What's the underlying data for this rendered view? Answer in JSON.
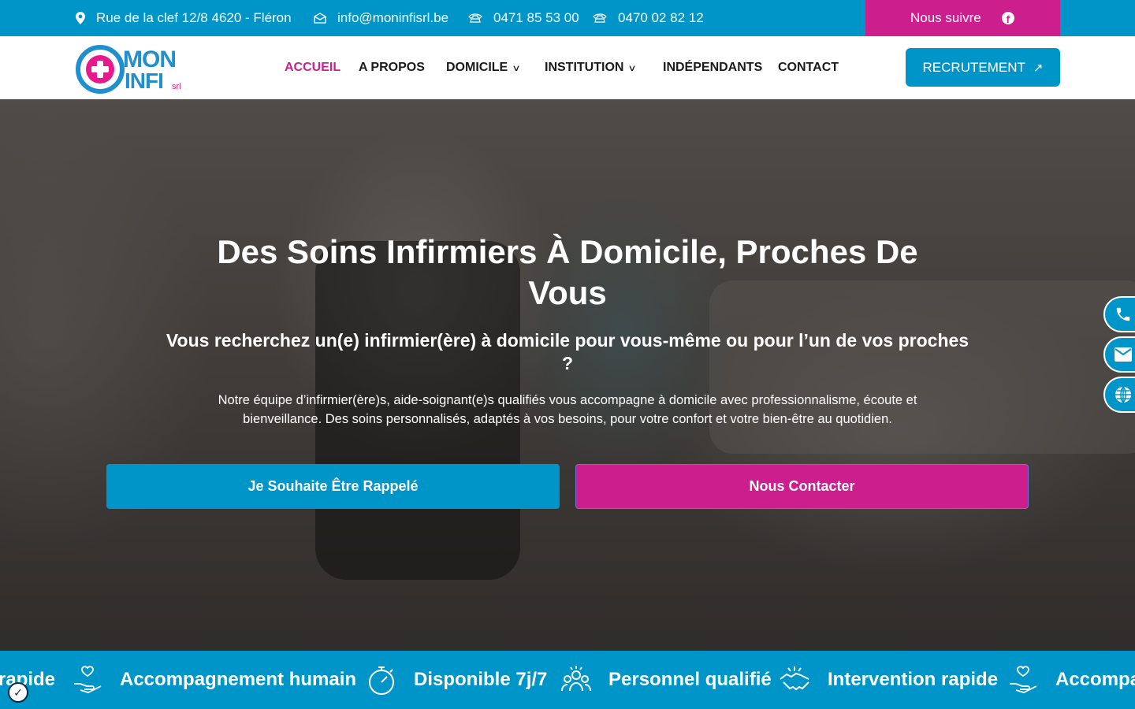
{
  "topbar": {
    "address": "Rue de la clef 12/8 4620 - Fléron",
    "email": "info@moninfisrl.be",
    "phone1": "0471 85 53 00",
    "phone2": "0470 02 82 12",
    "follow_label": "Nous suivre",
    "facebook_icon": "facebook-icon"
  },
  "logo": {
    "line1": "MON",
    "line2": "INFI",
    "suffix": "srl"
  },
  "nav": {
    "items": [
      {
        "label": "ACCUEIL"
      },
      {
        "label": "A PROPOS"
      },
      {
        "label": "DOMICILE"
      },
      {
        "label": "INSTITUTION"
      },
      {
        "label": "INDÉPENDANTS"
      },
      {
        "label": "CONTACT"
      }
    ],
    "recruit_label": "RECRUTEMENT"
  },
  "hero": {
    "title": "Des Soins Infirmiers À Domicile, Proches De Vous",
    "subtitle": "Vous recherchez un(e) infirmier(ère) à domicile pour vous-même ou pour l’un de vos proches ?",
    "description": "Notre équipe d’infirmier(ère)s, aide-soignant(e)s qualifiés vous accompagne à domicile avec professionnalisme, écoute et bienveillance. Des soins personnalisés, adaptés à vos besoins, pour votre confort et votre bien-être au quotidien.",
    "btn_callback": "Je Souhaite Être Rappelé",
    "btn_contact": "Nous Contacter"
  },
  "ticker": {
    "items": [
      {
        "label": "rapide",
        "icon": "handshake-icon"
      },
      {
        "label": "Accompagnement humain",
        "icon": "heart-hand-icon"
      },
      {
        "label": "Disponible 7j/7",
        "icon": "stopwatch-icon"
      },
      {
        "label": "Personnel qualifié",
        "icon": "team-icon"
      },
      {
        "label": "Intervention rapide",
        "icon": "handshake-icon"
      },
      {
        "label": "Accompa",
        "icon": "heart-hand-icon"
      }
    ]
  },
  "colors": {
    "primary": "#0095c9",
    "accent": "#cc1f8d"
  }
}
